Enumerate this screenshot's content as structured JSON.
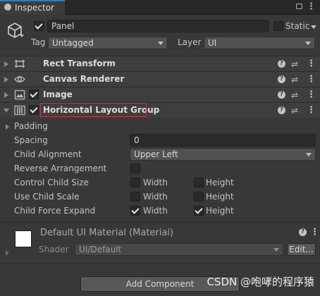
{
  "tab": {
    "title": "Inspector",
    "lock_icon": "lock-icon",
    "menu_icon": "kebab-menu-icon"
  },
  "header": {
    "object_icon": "cube-icon",
    "active_checked": true,
    "name": "Panel",
    "static_label": "Static",
    "static_checked": false,
    "tag_label": "Tag",
    "tag_value": "Untagged",
    "layer_label": "Layer",
    "layer_value": "UI"
  },
  "components": [
    {
      "title": "Rect Transform",
      "icon": "rect-transform-icon",
      "has_checkbox": false,
      "expanded": false
    },
    {
      "title": "Canvas Renderer",
      "icon": "eye-icon",
      "has_checkbox": false,
      "expanded": false
    },
    {
      "title": "Image",
      "icon": "image-icon",
      "has_checkbox": true,
      "checked": true,
      "expanded": false
    },
    {
      "title": "Horizontal Layout Group",
      "icon": "horizontal-layout-icon",
      "has_checkbox": true,
      "checked": true,
      "expanded": true
    }
  ],
  "layout_group": {
    "padding_label": "Padding",
    "spacing_label": "Spacing",
    "spacing_value": "0",
    "child_alignment_label": "Child Alignment",
    "child_alignment_value": "Upper Left",
    "reverse_label": "Reverse Arrangement",
    "reverse_checked": false,
    "control_size_label": "Control Child Size",
    "control_size_width": false,
    "control_size_height": false,
    "use_scale_label": "Use Child Scale",
    "use_scale_width": false,
    "use_scale_height": false,
    "force_expand_label": "Child Force Expand",
    "force_expand_width": true,
    "force_expand_height": true,
    "width_label": "Width",
    "height_label": "Height"
  },
  "material": {
    "name": "Default UI Material (Material)",
    "shader_label": "Shader",
    "shader_value": "UI/Default",
    "edit_label": "Edit..."
  },
  "add_component_label": "Add Component",
  "watermark": "CSDN @咆哮的程序猿",
  "colors": {
    "highlight": "#e03030",
    "tab_accent": "#3a79bb",
    "background": "#383838"
  }
}
